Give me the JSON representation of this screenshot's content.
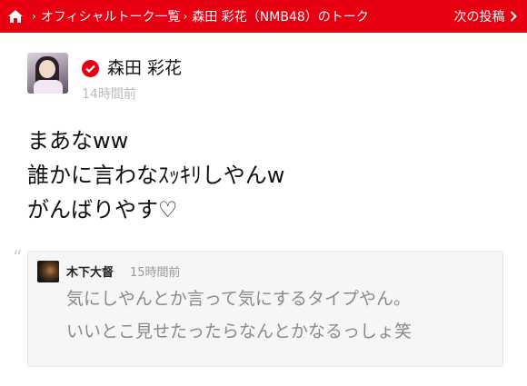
{
  "breadcrumb": {
    "home_icon": "home-icon",
    "separator": "›",
    "items": [
      "オフィシャルトーク一覧",
      "森田 彩花（NMB48）のトーク"
    ]
  },
  "next_post": {
    "label": "次の投稿",
    "icon": "chevron-right-icon"
  },
  "post": {
    "author": "森田 彩花",
    "verified_icon": "official-check-icon",
    "time": "14時間前",
    "lines": [
      "まあなww",
      "誰かに言わなｽｯｷﾘしやんw",
      "がんばりやす♡"
    ]
  },
  "reply": {
    "quote_mark": "“",
    "author": "木下大督",
    "time": "15時間前",
    "lines": [
      "気にしやんとか言って気にするタイプやん。",
      "いいとこ見せたったらなんとかなるっしょ笑"
    ]
  },
  "colors": {
    "brand_red": "#e60012",
    "time_gray": "#bbbbbb",
    "reply_bg": "#f6f6f6",
    "reply_text": "#8a8a8a"
  }
}
